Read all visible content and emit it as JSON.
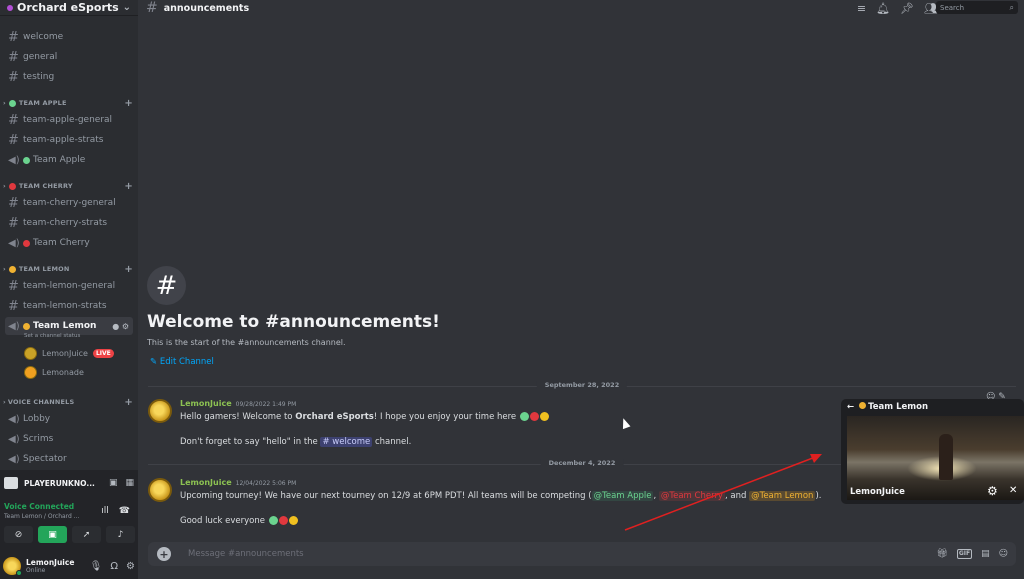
{
  "server": {
    "name": "Orchard eSports"
  },
  "sidebar": {
    "channels": [
      {
        "name": "welcome",
        "kind": "text"
      },
      {
        "name": "general",
        "kind": "text"
      },
      {
        "name": "testing",
        "kind": "text"
      }
    ],
    "categories": [
      {
        "label": "TEAM APPLE",
        "color": "#6bd38f",
        "channels": [
          {
            "name": "team-apple-general",
            "kind": "text"
          },
          {
            "name": "team-apple-strats",
            "kind": "text"
          },
          {
            "name": "Team Apple",
            "kind": "voice"
          }
        ]
      },
      {
        "label": "TEAM CHERRY",
        "color": "#e0383e",
        "channels": [
          {
            "name": "team-cherry-general",
            "kind": "text"
          },
          {
            "name": "team-cherry-strats",
            "kind": "text"
          },
          {
            "name": "Team Cherry",
            "kind": "voice"
          }
        ]
      },
      {
        "label": "TEAM LEMON",
        "color": "#f0b232",
        "channels": [
          {
            "name": "team-lemon-general",
            "kind": "text"
          },
          {
            "name": "team-lemon-strats",
            "kind": "text"
          },
          {
            "name": "Team Lemon",
            "kind": "voice",
            "status": "Set a channel status"
          }
        ]
      }
    ],
    "voice_users": [
      {
        "name": "LemonJuice",
        "badge": "LIVE"
      },
      {
        "name": "Lemonade"
      }
    ],
    "voice_category": {
      "label": "VOICE CHANNELS",
      "channels": [
        "Lobby",
        "Scrims",
        "Spectator"
      ]
    }
  },
  "topbar": {
    "channel": "announcements",
    "search_placeholder": "Search"
  },
  "welcome": {
    "title": "Welcome to #announcements!",
    "subtitle": "This is the start of the #announcements channel.",
    "edit": "Edit Channel"
  },
  "messages": [
    {
      "date": "September 28, 2022",
      "author": "LemonJuice",
      "timestamp": "09/28/2022 1:49 PM",
      "line1_a": "Hello gamers! Welcome to ",
      "line1_b": "Orchard eSports",
      "line1_c": "! I hope you enjoy your time here",
      "line2_a": "Don't forget to say \"hello\" in the ",
      "line2_mention": "# welcome",
      "line2_b": " channel."
    },
    {
      "date": "December 4, 2022",
      "author": "LemonJuice",
      "timestamp": "12/04/2022 5:06 PM",
      "line1_a": "Upcoming tourney! We have our next tourney on 12/9 at 6PM PDT! All teams will be competing (",
      "role1": "@Team Apple",
      "sep1": ", ",
      "role2": "@Team Cherry",
      "sep2": ", and ",
      "role3": "@Team Lemon",
      "line1_end": ").",
      "line2": "Good luck everyone"
    }
  ],
  "input": {
    "placeholder": "Message #announcements"
  },
  "popout": {
    "title": "Team Lemon",
    "streamer": "LemonJuice"
  },
  "user_area": {
    "game": "PLAYERUNKNO...",
    "voice_status": "Voice Connected",
    "voice_sub": "Team Lemon / Orchard ...",
    "username": "LemonJuice",
    "status": "Online"
  },
  "colors": {
    "accent": "#5865f2",
    "online": "#23a55a",
    "link": "#00a8fc"
  }
}
